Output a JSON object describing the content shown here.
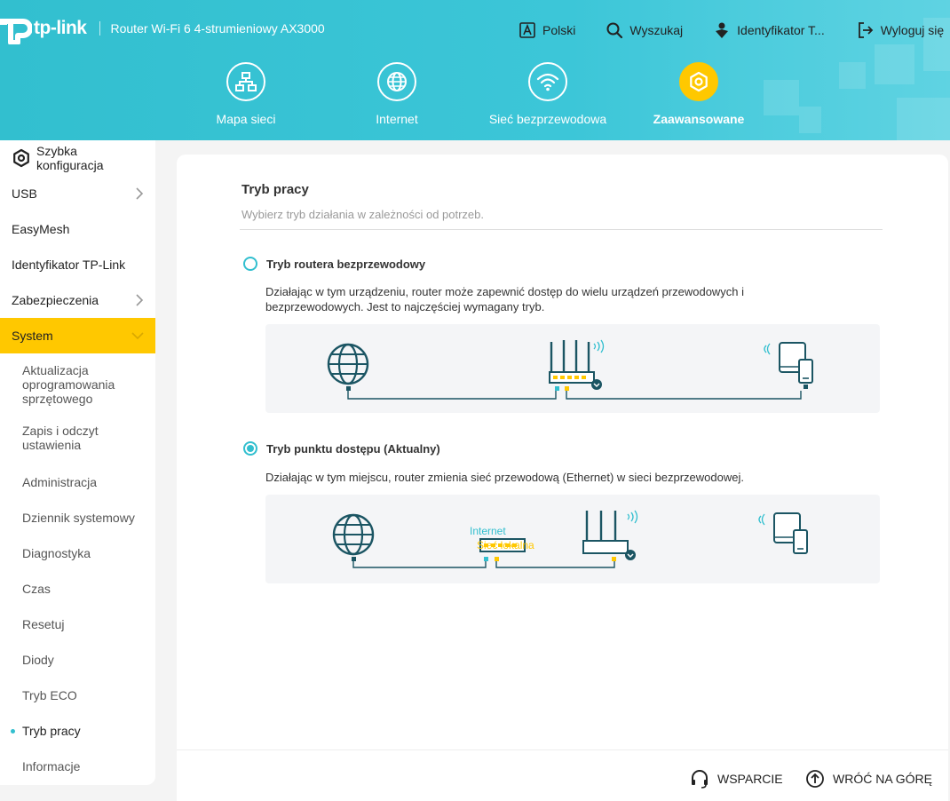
{
  "header": {
    "logo_text": "tp-link",
    "model": "Router Wi-Fi 6 4-strumieniowy AX3000",
    "actions": {
      "language": "Polski",
      "search": "Wyszukaj",
      "tplink_id": "Identyfikator T...",
      "logout": "Wyloguj się"
    },
    "nav": {
      "network_map": "Mapa sieci",
      "internet": "Internet",
      "wireless": "Sieć bezprzewodowa",
      "advanced": "Zaawansowane"
    },
    "accent_color": "#3cc6d8",
    "active_color": "#ffc800"
  },
  "sidebar": {
    "quick_setup": "Szybka konfiguracja",
    "usb": "USB",
    "easymesh": "EasyMesh",
    "tplink_id": "Identyfikator TP-Link",
    "security": "Zabezpieczenia",
    "system": "System",
    "sub": {
      "firmware": "Aktualizacja oprogramowania sprzętowego",
      "backup": "Zapis i odczyt ustawienia",
      "admin": "Administracja",
      "syslog": "Dziennik systemowy",
      "diagnostics": "Diagnostyka",
      "time": "Czas",
      "reset": "Resetuj",
      "leds": "Diody",
      "eco": "Tryb ECO",
      "op_mode": "Tryb pracy",
      "info": "Informacje"
    }
  },
  "content": {
    "title": "Tryb pracy",
    "description": "Wybierz tryb działania w zależności od potrzeb.",
    "mode_router": {
      "label": "Tryb routera bezprzewodowy",
      "description": "Działając w tym urządzeniu, router może zapewnić dostęp do wielu urządzeń przewodowych i bezprzewodowych. Jest to najczęściej wymagany tryb.",
      "selected": false
    },
    "mode_ap": {
      "label": "Tryb punktu dostępu (Aktualny)",
      "description": "Działając w tym miejscu, router zmienia sieć przewodową (Ethernet) w sieci bezprzewodowej.",
      "selected": true,
      "diagram_label_internet": "Internet",
      "diagram_label_lan": "Sieć lokalna"
    }
  },
  "footer": {
    "support": "WSPARCIE",
    "back_to_top": "WRÓĆ NA GÓRĘ"
  }
}
